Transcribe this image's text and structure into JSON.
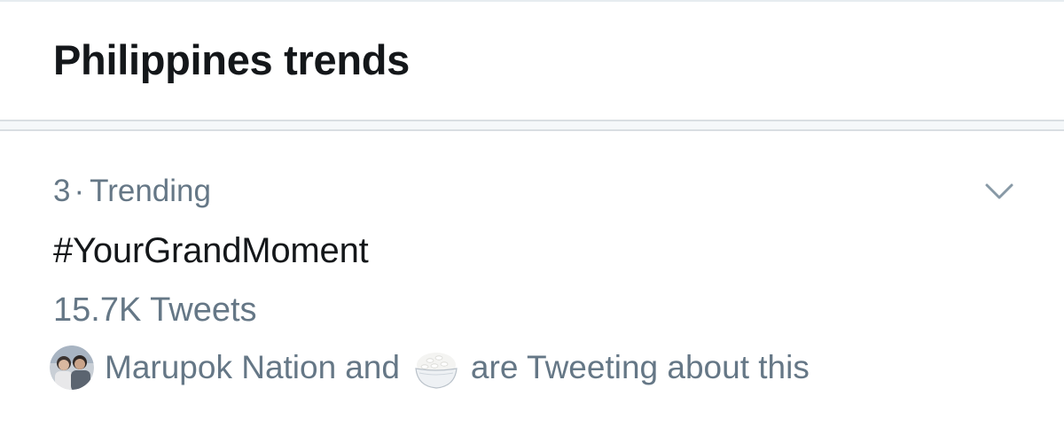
{
  "header": {
    "title": "Philippines trends"
  },
  "trend": {
    "rank": "3",
    "separator": "·",
    "category": "Trending",
    "name": "#YourGrandMoment",
    "tweet_count": "15.7K Tweets",
    "context": {
      "user_name": "Marupok Nation",
      "connector": "and",
      "emoji_name": "rice-bowl",
      "suffix": "are Tweeting about this"
    },
    "menu_icon": "chevron-down-icon"
  },
  "colors": {
    "primary_text": "#14171a",
    "secondary_text": "#657786",
    "divider": "#d9dee2",
    "background": "#ffffff"
  }
}
